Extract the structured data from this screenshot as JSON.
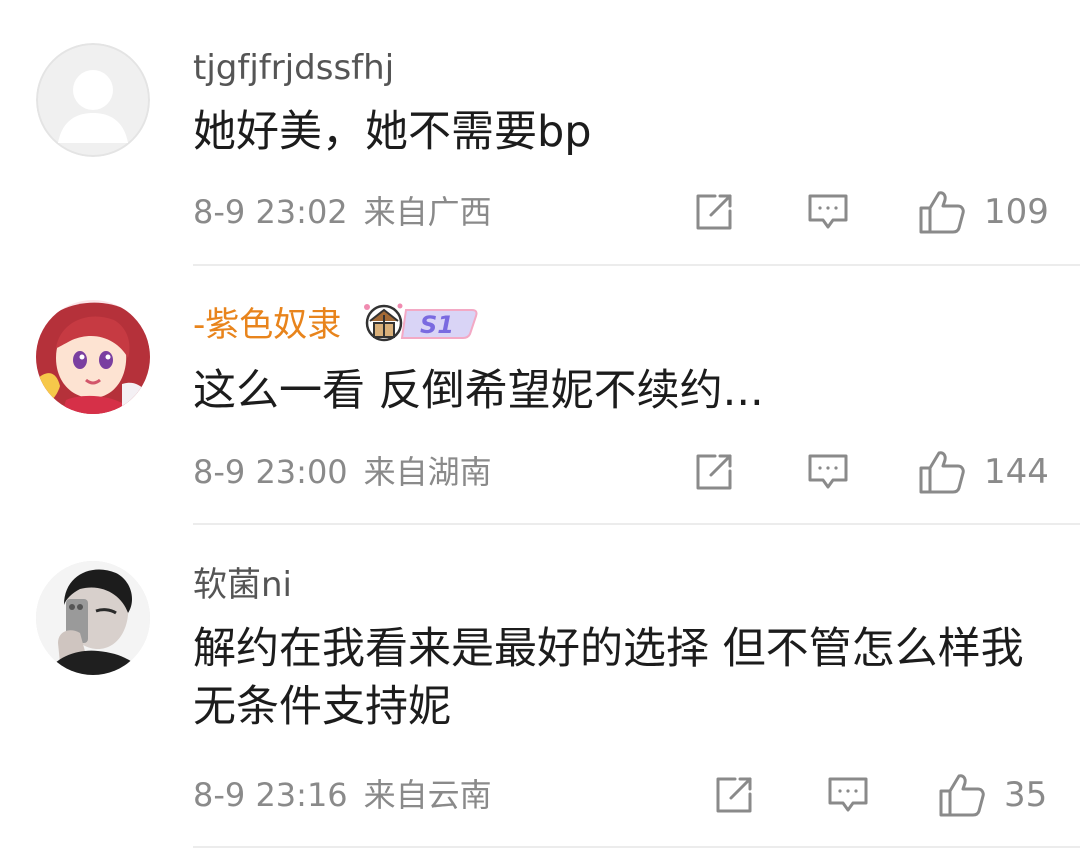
{
  "comments": [
    {
      "username": "tjgfjfrjdssfhj",
      "text": "她好美，她不需要bp",
      "time": "8-9 23:02",
      "location": "来自广西",
      "likes": "109"
    },
    {
      "username": "-紫色奴隶",
      "badge_text": "S1",
      "text": "这么一看 反倒希望妮不续约...",
      "time": "8-9 23:00",
      "location": "来自湖南",
      "likes": "144"
    },
    {
      "username": "软菌ni",
      "text": "解约在我看来是最好的选择 但不管怎么样我无条件支持妮",
      "time": "8-9 23:16",
      "location": "来自云南",
      "likes": "35"
    }
  ],
  "colors": {
    "vip_username": "#e8841c",
    "username": "#555555",
    "meta": "#8a8a8a",
    "text": "#1c1c1c",
    "divider": "#ececec"
  },
  "icons": [
    "default-avatar-icon",
    "share-icon",
    "reply-icon",
    "thumbs-up-icon",
    "vip-badge-icon"
  ]
}
